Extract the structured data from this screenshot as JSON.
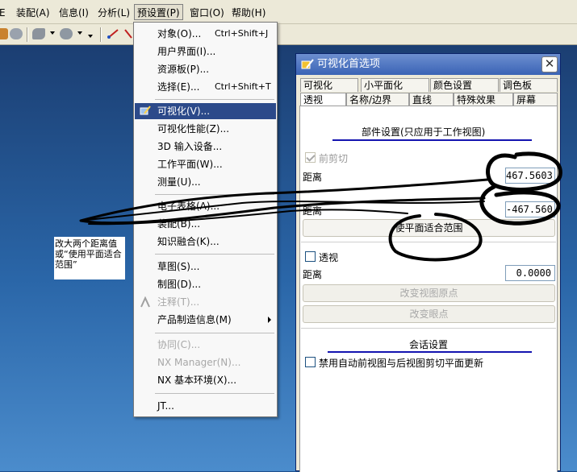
{
  "menubar": {
    "items": [
      "装配(A)",
      "信息(I)",
      "分析(L)",
      "预设置(P)",
      "窗口(O)",
      "帮助(H)"
    ],
    "active_index": 3,
    "partial_left": "E"
  },
  "dropdown": {
    "items": [
      {
        "label": "对象(O)...",
        "shortcut": "Ctrl+Shift+J"
      },
      {
        "label": "用户界面(I)..."
      },
      {
        "label": "资源板(P)..."
      },
      {
        "label": "选择(E)...",
        "shortcut": "Ctrl+Shift+T"
      },
      {
        "label": "可视化(V)...",
        "selected": true
      },
      {
        "label": "可视化性能(Z)..."
      },
      {
        "label": "3D 输入设备..."
      },
      {
        "label": "工作平面(W)..."
      },
      {
        "label": "测量(U)..."
      },
      {
        "label": "电子表格(A)..."
      },
      {
        "label": "装配(B)..."
      },
      {
        "label": "知识融合(K)..."
      },
      {
        "label": "草图(S)..."
      },
      {
        "label": "制图(D)..."
      },
      {
        "label": "注释(T)...",
        "disabled": true
      },
      {
        "label": "产品制造信息(M)",
        "submenu": true
      },
      {
        "label": "协同(C)...",
        "disabled": true
      },
      {
        "label": "NX Manager(N)...",
        "disabled": true
      },
      {
        "label": "NX 基本环境(X)..."
      },
      {
        "label": "JT..."
      }
    ]
  },
  "note": {
    "text": "改大两个距离值或“使用平面适合范围”"
  },
  "dialog": {
    "title": "可视化首选项",
    "close_glyph": "✕",
    "tabs_row1": [
      "可视化",
      "小平面化",
      "颜色设置",
      "调色板"
    ],
    "tabs_row2": [
      "透视",
      "名称/边界",
      "直线",
      "特殊效果",
      "屏幕"
    ],
    "active_tab": "透视",
    "section1_title": "部件设置(只应用于工作视图)",
    "front_clip_label": "前剪切",
    "distance_label": "距离",
    "front_distance": "467.5603",
    "back_distance": "-467.560",
    "fit_planes_button": "使平面适合范围",
    "perspective_label": "透视",
    "perspective_distance": "0.0000",
    "change_view_origin_button": "改变视图原点",
    "change_eye_point_button": "改变眼点",
    "section2_title": "会话设置",
    "disable_auto_clip_label": "禁用自动前视图与后视图剪切平面更新"
  }
}
